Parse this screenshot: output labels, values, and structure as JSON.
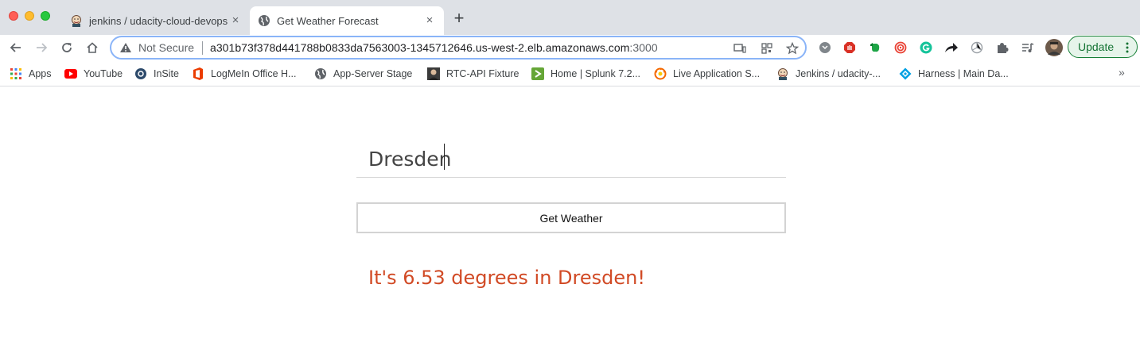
{
  "window": {
    "tabs": [
      {
        "title": "jenkins / udacity-cloud-devops",
        "active": false,
        "close": "×"
      },
      {
        "title": "Get Weather Forecast",
        "active": true,
        "close": "×"
      }
    ],
    "new_tab": "+"
  },
  "toolbar": {
    "security_label": "Not Secure",
    "url_main": "a301b73f378d441788b0833da7563003-1345712646.us-west-2.elb.amazonaws.com",
    "url_port": ":3000",
    "update_label": "Update"
  },
  "bookmarks": {
    "items": [
      {
        "label": "Apps",
        "icon": "apps-grid-icon"
      },
      {
        "label": "YouTube",
        "icon": "youtube-icon"
      },
      {
        "label": "InSite",
        "icon": "insite-icon"
      },
      {
        "label": "LogMeIn Office H...",
        "icon": "office-icon"
      },
      {
        "label": "App-Server Stage",
        "icon": "globe-icon"
      },
      {
        "label": "RTC-API Fixture",
        "icon": "avatar-icon"
      },
      {
        "label": "Home | Splunk 7.2...",
        "icon": "splunk-icon"
      },
      {
        "label": "Live Application S...",
        "icon": "grafana-icon"
      },
      {
        "label": "Jenkins / udacity-...",
        "icon": "jenkins-icon"
      },
      {
        "label": "Harness | Main Da...",
        "icon": "harness-icon"
      }
    ],
    "overflow": "»"
  },
  "page": {
    "city_value": "Dresden",
    "button_label": "Get Weather",
    "result_text": "It's 6.53 degrees in Dresden!"
  },
  "colors": {
    "result": "#d14a25",
    "accent": "#8ab4f8",
    "update_green": "#137333"
  }
}
